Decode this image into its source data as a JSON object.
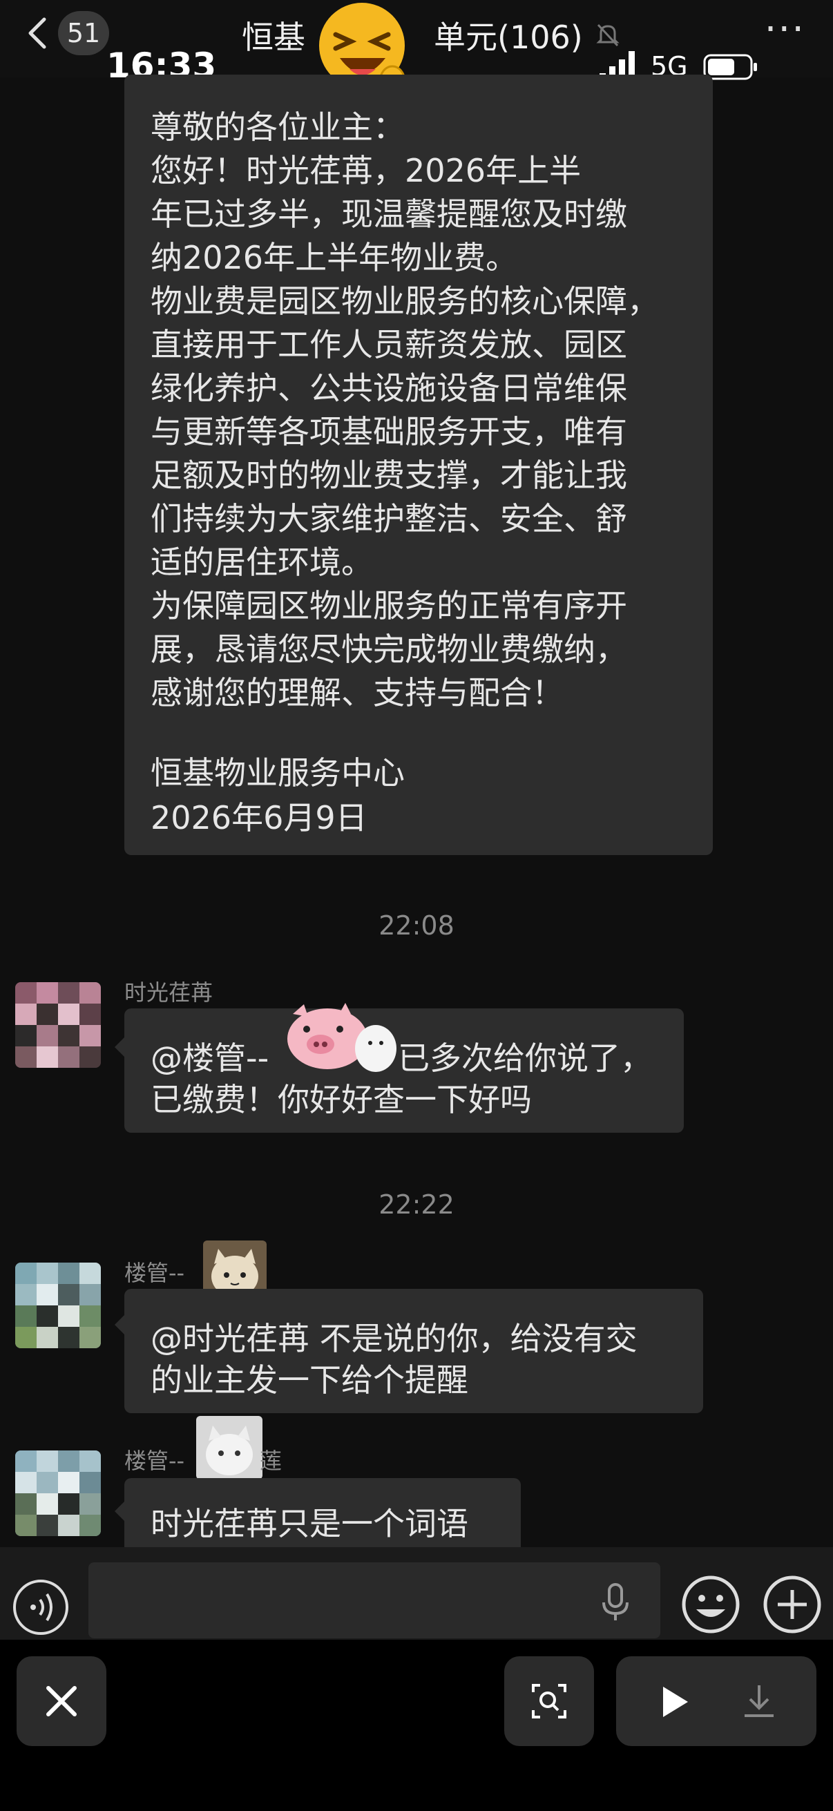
{
  "header": {
    "unread_count": "51",
    "title_left": "恒基",
    "title_right": "单元(106)",
    "more_label": "···"
  },
  "status_bar": {
    "time": "16:33",
    "network": "5G"
  },
  "notice_message": {
    "lines": [
      "尊敬的各位业主：",
      "    您好！时光荏苒，2026年上半",
      "年已过多半，现温馨提醒您及时缴",
      "纳2026年上半年物业费。",
      "物业费是园区物业服务的核心保障，",
      "直接用于工作人员薪资发放、园区",
      "绿化养护、公共设施设备日常维保",
      "与更新等各项基础服务开支，唯有",
      "足额及时的物业费支撑，才能让我",
      "们持续为大家维护整洁、安全、舒",
      "适的居住环境。",
      " 为保障园区物业服务的正常有序开",
      "展，恳请您尽快完成物业费缴纳，",
      "感谢您的理解、支持与配合！",
      "",
      "        恒基物业服务中心",
      "          2026年6月9日"
    ]
  },
  "timestamps": [
    "22:08",
    "22:22"
  ],
  "messages": [
    {
      "sender": "时光荏苒",
      "lines": [
        "@楼管--",
        "已多次给你说了，",
        "已缴费！你好好查一下好吗"
      ]
    },
    {
      "sender": "楼管--",
      "lines": [
        "@时光荏苒 不是说的你，给没有交",
        "的业主发一下给个提醒"
      ]
    },
    {
      "sender": "楼管--",
      "sender_suffix": "莲",
      "lines": [
        "时光荏苒只是一个词语"
      ]
    }
  ],
  "colors": {
    "background": "#0f0f0f",
    "bubble": "#2d2d2d",
    "timestamp": "#8a8a8a",
    "text": "#e7e7e7"
  },
  "icons": [
    "back-chevron-icon",
    "bell-muted-icon",
    "signal-icon",
    "battery-icon",
    "voice-icon",
    "mic-icon",
    "emoji-icon",
    "plus-icon",
    "close-icon",
    "scan-icon",
    "play-icon",
    "download-icon"
  ]
}
